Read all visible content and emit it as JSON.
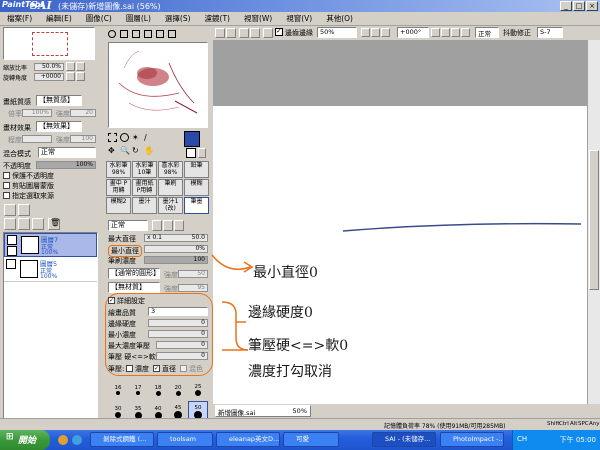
{
  "titlebar": {
    "logo_small": "PaintTool",
    "logo_large": "SAI",
    "title": "(未儲存)新增圖像.sai (56%)",
    "btn_min": "_",
    "btn_max": "□",
    "btn_close": "×"
  },
  "menu": [
    "檔案(F)",
    "編輯(E)",
    "圖像(C)",
    "圖層(L)",
    "選擇(S)",
    "濾鏡(T)",
    "視窗(W)",
    "視窗(V)",
    "其他(O)"
  ],
  "toolbar": {
    "antialias_label": "邊齒邊緣",
    "zoom_value": "50%",
    "rotation_value": "+000°",
    "blend_value": "正常",
    "stabilizer_label": "抖動修正",
    "stabilizer_value": "S-7"
  },
  "nav": {
    "zoom_label": "縮放比率",
    "zoom_value": "50.0%",
    "angle_label": "旋轉角度",
    "angle_value": "+0000"
  },
  "texture": {
    "paper_label": "畫紙質感",
    "paper_value": "【無質感】",
    "scale_label": "倍率",
    "scale_value": "100%",
    "strength_label": "強度",
    "strength_value": "20",
    "effect_label": "畫材效果",
    "effect_value": "【無效果】",
    "degree_label": "程度",
    "effect_strength_value": "100"
  },
  "layer_props": {
    "blend_label": "混合模式",
    "blend_value": "正常",
    "opacity_label": "不透明度",
    "opacity_value": "100%",
    "opacity_pct": 100,
    "checks": [
      "保護不透明度",
      "剪貼圖層蒙版",
      "指定選取來源"
    ]
  },
  "layers": [
    {
      "name": "圖層7",
      "mode": "正常",
      "opacity": "100%"
    },
    {
      "name": "圖層5",
      "mode": "正常",
      "opacity": "100%"
    }
  ],
  "tools": {
    "tabs": [
      "水彩筆 98%",
      "水彩筆 10筆",
      "喜水彩 98%",
      "鉛筆",
      "畫中 P用轉",
      "畫用紙 P用轉",
      "筆刷",
      "模糊",
      "模糊2",
      "墨汁",
      "墨汁1 (改)",
      "筆墨"
    ],
    "active_tab": 11
  },
  "brush": {
    "mode_value": "正常",
    "max_size_label": "最大直徑",
    "max_size_mult": "x 0.1",
    "max_size_value": "50.0",
    "min_size_label": "最小直徑",
    "min_size_value": "0%",
    "density_label": "筆刷濃度",
    "density_value": "100",
    "density_pct": 100,
    "shape_value": "【通常的圓形】",
    "shape_strength_label": "強度",
    "shape_strength_value": "50",
    "texture_value": "【無材質】",
    "texture_strength_label": "強度",
    "texture_strength_value": "95",
    "advanced_label": "詳細設定",
    "quality_label": "繪畫品質",
    "quality_value": "3",
    "edge_label": "邊緣硬度",
    "edge_value": "0",
    "min_density_label": "最小濃度",
    "min_density_value": "0",
    "max_pressure_label": "最大濃度筆壓",
    "max_pressure_value": "0",
    "hard_soft_label": "筆壓 硬<=>軟",
    "hard_soft_value": "0",
    "pressure_label": "筆壓:",
    "pressure_density": "濃度",
    "pressure_size": "直徑",
    "pressure_blend": "混色"
  },
  "brush_sizes": [
    "16",
    "17",
    "18",
    "20",
    "25",
    "30",
    "35",
    "40",
    "45",
    "50",
    "60",
    "70",
    "80",
    "100",
    "120"
  ],
  "annotations": {
    "min_size": "最小直徑0",
    "edge": "邊緣硬度0",
    "pressure": "筆壓硬<=>軟0",
    "density": "濃度打勾取消",
    "arrow_color": "#e8731a"
  },
  "canvas_tab": {
    "name": "新增圖像.sai",
    "zoom": "50%"
  },
  "status": {
    "memory": "記憶體負荷率 78% (使用91MB/可用285MB)",
    "indicators": [
      "Shift",
      "Ctrl",
      "Alt",
      "SPC",
      "Any"
    ]
  },
  "taskbar": {
    "start": "開始",
    "buttons": [
      "剝除式鋼鐵 (...",
      "toolsam",
      "eleanap英文D...",
      "可愛",
      "SAI - (未儲存...",
      "PhotoImpact -...",
      "CH"
    ],
    "clock": "下午 05:00"
  }
}
